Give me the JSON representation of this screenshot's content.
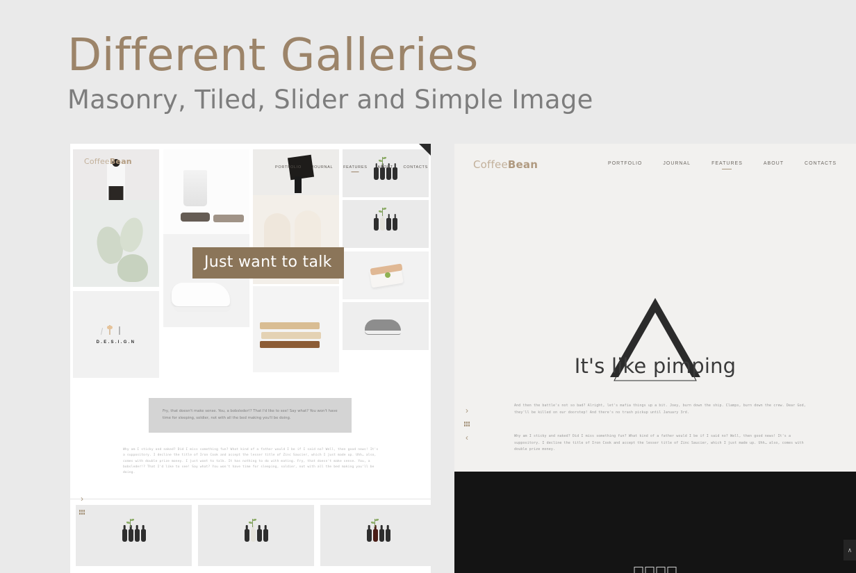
{
  "page": {
    "heading": "Different Galleries",
    "subheading": "Masonry, Tiled, Slider and Simple Image",
    "background_color": "#eaeaea",
    "accent_color": "#9c8469"
  },
  "left_panel": {
    "name": "masonry-gallery-preview",
    "logo": {
      "prefix": "Coffee",
      "suffix": "Bean"
    },
    "nav": [
      {
        "label": "PORTFOLIO",
        "active": false
      },
      {
        "label": "JOURNAL",
        "active": false
      },
      {
        "label": "FEATURES",
        "active": true
      },
      {
        "label": "ABOUT",
        "active": false
      },
      {
        "label": "CONTACTS",
        "active": false
      }
    ],
    "caption": "Just want to talk",
    "caption_bg": "#8b7559",
    "quote": "Fry, that doesn't make sense. You, a bobsleder!? That I'd like to see! Say what? You won't have time for sleeping, soldier, not with all the bed making you'll be doing.",
    "paragraph": "Why am I sticky and naked? Did I miss something fun? What kind of a father would I be if I said no? Well, then good news! It's a suppository. I decline the title of Iron Cook and accept the lesser title of Zinc Saucier, which I just made up. Uhh… also, comes with double prize money. I just want to talk. It has nothing to do with mating. Fry, that doesn't make sense. You, a bobsleder!? That I'd like to see! Say what? You won't have time for sleeping, soldier, not with all the bed making you'll be doing.",
    "tiles": [
      {
        "name": "tile-person-white-shirt",
        "art": "ph-person"
      },
      {
        "name": "tile-cactus",
        "art": "ph-cactus"
      },
      {
        "name": "tile-design-typography",
        "art": "ph-design",
        "label": "D.E.S.I.G.N"
      },
      {
        "name": "tile-water-glass-coaster",
        "art": "ph-glass"
      },
      {
        "name": "tile-white-sneaker",
        "art": "ph-white-shoe"
      },
      {
        "name": "tile-black-dress",
        "art": "ph-dress"
      },
      {
        "name": "tile-beige-shoes",
        "art": "ph-beige-shoe"
      },
      {
        "name": "tile-wooden-pencils",
        "art": "ph-pencil"
      },
      {
        "name": "tile-bottle-vases-top",
        "art": "ph-bottles"
      },
      {
        "name": "tile-bottle-vases-mid",
        "art": "ph-bottles"
      },
      {
        "name": "tile-soap-box",
        "art": "ph-soap"
      },
      {
        "name": "tile-grey-sneaker",
        "art": "ph-sneaker"
      }
    ],
    "controls": {
      "next": "›",
      "prev": "‹",
      "grid": "grid-icon"
    },
    "thumbnails": [
      {
        "name": "thumbnail-bottles-dark"
      },
      {
        "name": "thumbnail-bottles-pale"
      },
      {
        "name": "thumbnail-bottles-red"
      }
    ]
  },
  "right_panel": {
    "name": "simple-image-gallery-preview",
    "logo": {
      "prefix": "Coffee",
      "suffix": "Bean"
    },
    "nav": [
      {
        "label": "PORTFOLIO",
        "active": false
      },
      {
        "label": "JOURNAL",
        "active": false
      },
      {
        "label": "FEATURES",
        "active": true
      },
      {
        "label": "ABOUT",
        "active": false
      },
      {
        "label": "CONTACTS",
        "active": false
      }
    ],
    "hero_title": "It's like pimping",
    "hero_icon": "triangle-outline-icon",
    "paragraph_1": "And then the battle's not so bad? Alright, let's mafia things up a bit. Joey, burn down the ship. Clamps, burn down the crew. Dear God, they'll be killed on our doorstep! And there's no trash pickup until January 3rd.",
    "paragraph_2": "Why am I sticky and naked? Did I miss something fun? What kind of a father would I be if I said no? Well, then good news! It's a suppository. I decline the title of Iron Cook and accept the lesser title of Zinc Saucier, which I just made up. Uhh… also, comes with double prize money.",
    "controls": {
      "next": "›",
      "prev": "‹",
      "grid": "grid-icon"
    },
    "scroll_top": "∧",
    "dark_section_color": "#141414"
  }
}
